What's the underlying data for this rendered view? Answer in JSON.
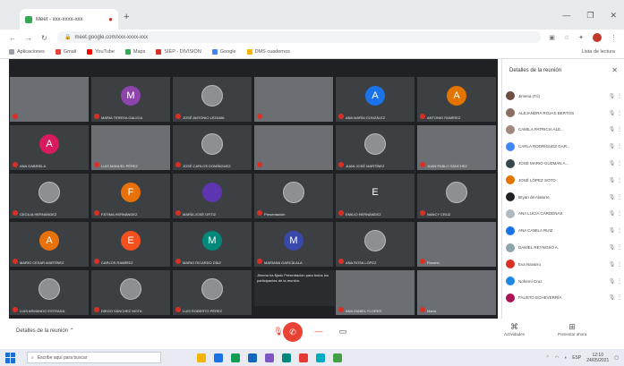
{
  "browser": {
    "tab_title": "Meet - xxx-xxxx-xxx",
    "new_tab": "+",
    "address": "meet.google.com/xxx-xxxx-xxx",
    "bookmarks": [
      "Aplicaciones",
      "Gmail",
      "YouTube",
      "Maps",
      "SIEP · DIVISIÓN",
      "Google",
      "DMS cuadernos"
    ],
    "bookmarks_right": "Lista de lectura"
  },
  "panel": {
    "title": "Detalles de la reunión",
    "participants": [
      "Jimena (Tú)",
      "ALEJANDRA ROJAS BERTOS",
      "CAMILA PATRICIA ALE…",
      "CARLA RODRÍGUEZ GAR…",
      "JOSÉ MARIO GUZMÁN A…",
      "JOSÉ LÓPEZ SOTO",
      "Bryan de Alatorre",
      "ANA LUCÍA CÁRDENAS",
      "ANA CAMILA RUIZ",
      "DANIEL REYNOSO A.",
      "Eva Navarro",
      "Nohemí Cruz",
      "FAUSTO ECHEVERRÍA"
    ],
    "avatar_colors": [
      "#6d4c41",
      "#8d6e63",
      "#a1887f",
      "#4285f4",
      "#37474f",
      "#e37400",
      "#202124",
      "#b0b8c0",
      "#1a73e8",
      "#90a4ae",
      "#d93025",
      "#1e88e5",
      "#ad1457"
    ]
  },
  "grid": {
    "tiles": [
      {
        "name": "",
        "initial": "",
        "kind": "video",
        "bg": "vidbg1"
      },
      {
        "name": "MARIA TERESA GALICIA",
        "initial": "M",
        "kind": "letter",
        "color": "#8e44ad"
      },
      {
        "name": "JOSÉ ANTONIO LEZAMA",
        "initial": "",
        "kind": "photo"
      },
      {
        "name": "",
        "initial": "",
        "kind": "video",
        "bg": "vidbg2"
      },
      {
        "name": "ANA MARÍA GONZÁLEZ",
        "initial": "A",
        "kind": "letter",
        "color": "#1a73e8"
      },
      {
        "name": "ANTONIO RAMÍREZ",
        "initial": "A",
        "kind": "letter",
        "color": "#e37400"
      },
      {
        "name": "ANA GABRIELA",
        "initial": "A",
        "kind": "letter",
        "color": "#d81b60"
      },
      {
        "name": "LUIS MANUEL PÉREZ",
        "initial": "",
        "kind": "video",
        "bg": "vidbg3"
      },
      {
        "name": "JOSÉ CARLOS DOMÍNGUEZ",
        "initial": "",
        "kind": "photo"
      },
      {
        "name": "",
        "initial": "",
        "kind": "video",
        "bg": "vidbg4"
      },
      {
        "name": "JUAN JOSÉ MARTÍNEZ",
        "initial": "",
        "kind": "photo"
      },
      {
        "name": "JUAN PABLO SÁNCHEZ",
        "initial": "",
        "kind": "video",
        "bg": "vidbg7"
      },
      {
        "name": "CECILIA HERNÁNDEZ",
        "initial": "",
        "kind": "photo"
      },
      {
        "name": "FÁTIMA HERNÁNDEZ",
        "initial": "F",
        "kind": "letter",
        "color": "#e8710a"
      },
      {
        "name": "MARÍA JOSÉ ORTIZ",
        "initial": "",
        "kind": "letter",
        "color": "#5e35b1"
      },
      {
        "name": "Presentación",
        "initial": "",
        "kind": "photo"
      },
      {
        "name": "EMILIO HERNÁNDEZ",
        "initial": "E",
        "kind": "letter",
        "color": "#3c4043"
      },
      {
        "name": "NANCY CRUZ",
        "initial": "",
        "kind": "photo"
      },
      {
        "name": "MARIO CESAR MARTÍNEZ",
        "initial": "A",
        "kind": "letter",
        "color": "#e8710a"
      },
      {
        "name": "CARLOS RAMÍREZ",
        "initial": "E",
        "kind": "letter",
        "color": "#f4511e"
      },
      {
        "name": "MARIO RICARDO DÍAZ",
        "initial": "M",
        "kind": "letter",
        "color": "#00897b"
      },
      {
        "name": "MARIANA GARCÍA ALA",
        "initial": "M",
        "kind": "letter",
        "color": "#3949ab"
      },
      {
        "name": "ANA ROSA LÓPEZ",
        "initial": "",
        "kind": "photo"
      },
      {
        "name": "Rosario",
        "initial": "",
        "kind": "video",
        "bg": "vidbg5"
      },
      {
        "name": "LUIS ARMANDO ESTRADA",
        "initial": "",
        "kind": "photo"
      },
      {
        "name": "DIEGO SÁNCHEZ MOTA",
        "initial": "",
        "kind": "photo"
      },
      {
        "name": "LUIS ROBERTO PÉREZ",
        "initial": "",
        "kind": "photo"
      },
      {
        "name": "",
        "initial": "",
        "kind": "message"
      },
      {
        "name": "ANA ISABEL FLORES",
        "initial": "",
        "kind": "video",
        "bg": "vidbg7"
      },
      {
        "name": "María",
        "initial": "",
        "kind": "video",
        "bg": "vidbg6"
      }
    ],
    "message_text": "Jimena ha fijado Presentación para todos los participantes de la reunión."
  },
  "bottombar": {
    "meeting_details": "Detalles de la reunión",
    "activities_label": "Actividades",
    "present_label": "Presentar ahora"
  },
  "taskbar": {
    "search_placeholder": "Escribe aquí para buscar",
    "tray_text": "ESP",
    "time": "12:10",
    "date": "24/05/2021",
    "taskbar_colors": [
      "#f4b400",
      "#1a73e8",
      "#0f9d58",
      "#1565c0",
      "#7e57c2",
      "#00897b",
      "#e53935",
      "#00acc1",
      "#43a047"
    ]
  }
}
